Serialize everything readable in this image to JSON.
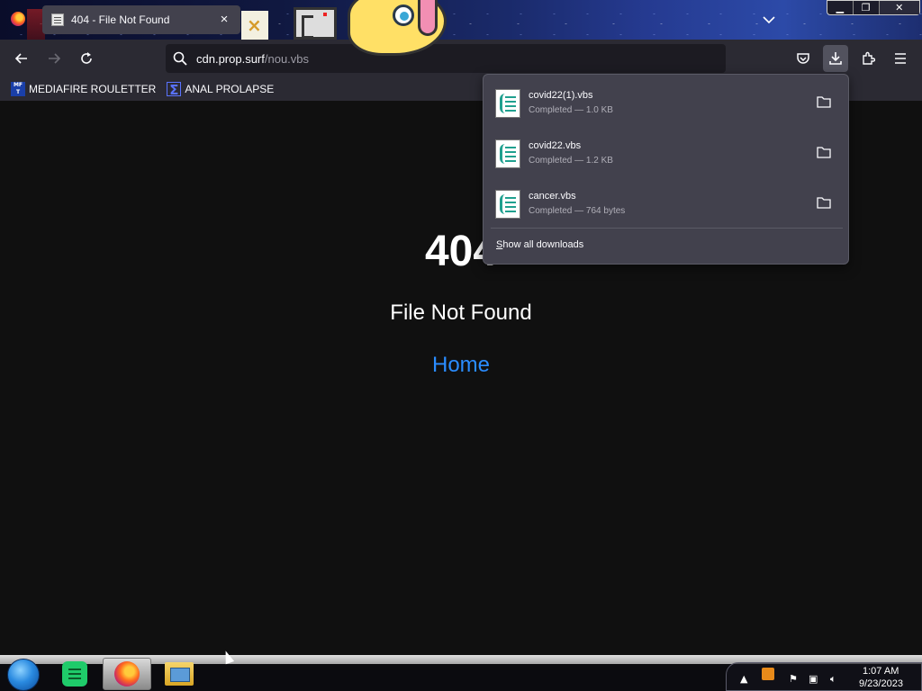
{
  "browser": {
    "tab": {
      "title": "404 - File Not Found"
    },
    "url": {
      "host": "cdn.prop.surf",
      "path": "/nou.vbs"
    },
    "bookmarks": [
      {
        "label": "MEDIAFIRE ROULETTER",
        "icon": "mediafire-icon",
        "icon_text": "MF T"
      },
      {
        "label": "ANAL PROLAPSE",
        "icon": "sigma-icon",
        "icon_text": "Σ"
      }
    ]
  },
  "page": {
    "code": "404",
    "message": "File Not Found",
    "home_link": "Home"
  },
  "downloads": {
    "items": [
      {
        "name": "covid22(1).vbs",
        "status": "Completed — 1.0 KB"
      },
      {
        "name": "covid22.vbs",
        "status": "Completed — 1.2 KB"
      },
      {
        "name": "cancer.vbs",
        "status": "Completed — 764 bytes"
      }
    ],
    "show_all_prefix": "S",
    "show_all_rest": "how all downloads"
  },
  "taskbar": {
    "clock": {
      "time": "1:07 AM",
      "date": "9/23/2023"
    },
    "apps": [
      "start-orb",
      "green-notes-app",
      "firefox-app",
      "file-explorer-app"
    ]
  },
  "colors": {
    "accent_link": "#2a8cff",
    "panel_bg": "#42414d",
    "toolbar_bg": "#2b2a33",
    "page_bg": "#101010"
  }
}
